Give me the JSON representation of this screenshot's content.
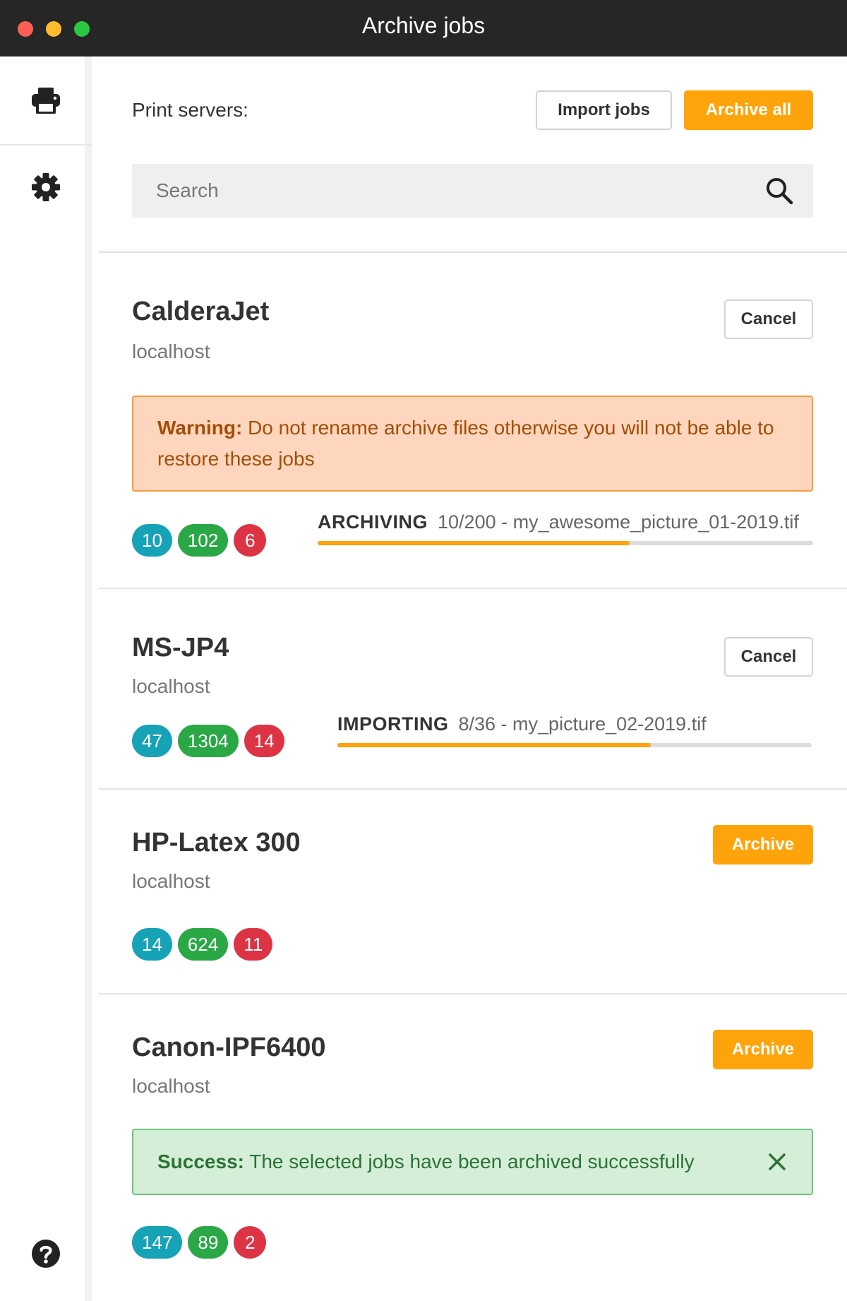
{
  "window": {
    "title": "Archive jobs"
  },
  "sidebar": {
    "items": [
      {
        "icon": "printer-icon"
      },
      {
        "icon": "gear-icon"
      },
      {
        "icon": "help-icon"
      }
    ]
  },
  "toolbar": {
    "print_servers_label": "Print servers:",
    "import_label": "Import jobs",
    "archive_all_label": "Archive all"
  },
  "search": {
    "placeholder": "Search",
    "value": ""
  },
  "colors": {
    "accent": "#ffa30a",
    "titlebar": "#262626",
    "cyan": "#16a2b7",
    "green": "#2aa846",
    "red": "#dc3444"
  },
  "servers": [
    {
      "name": "CalderaJet",
      "host": "localhost",
      "action": "Cancel",
      "warning": {
        "label": "Warning:",
        "text": "Do not rename archive files otherwise you will not be able to restore these jobs"
      },
      "counts": [
        "10",
        "102",
        "6"
      ],
      "progress": {
        "state": "ARCHIVING",
        "detail": "10/200 - my_awesome_picture_01-2019.tif",
        "fraction": 0.63
      }
    },
    {
      "name": "MS-JP4",
      "host": "localhost",
      "action": "Cancel",
      "counts": [
        "47",
        "1304",
        "14"
      ],
      "progress": {
        "state": "IMPORTING",
        "detail": "8/36 - my_picture_02-2019.tif",
        "fraction": 0.66
      }
    },
    {
      "name": "HP-Latex 300",
      "host": "localhost",
      "action": "Archive",
      "counts": [
        "14",
        "624",
        "11"
      ]
    },
    {
      "name": "Canon-IPF6400",
      "host": "localhost",
      "action": "Archive",
      "success": {
        "label": "Success:",
        "text": "The selected jobs have been archived successfully"
      },
      "counts": [
        "147",
        "89",
        "2"
      ]
    }
  ]
}
